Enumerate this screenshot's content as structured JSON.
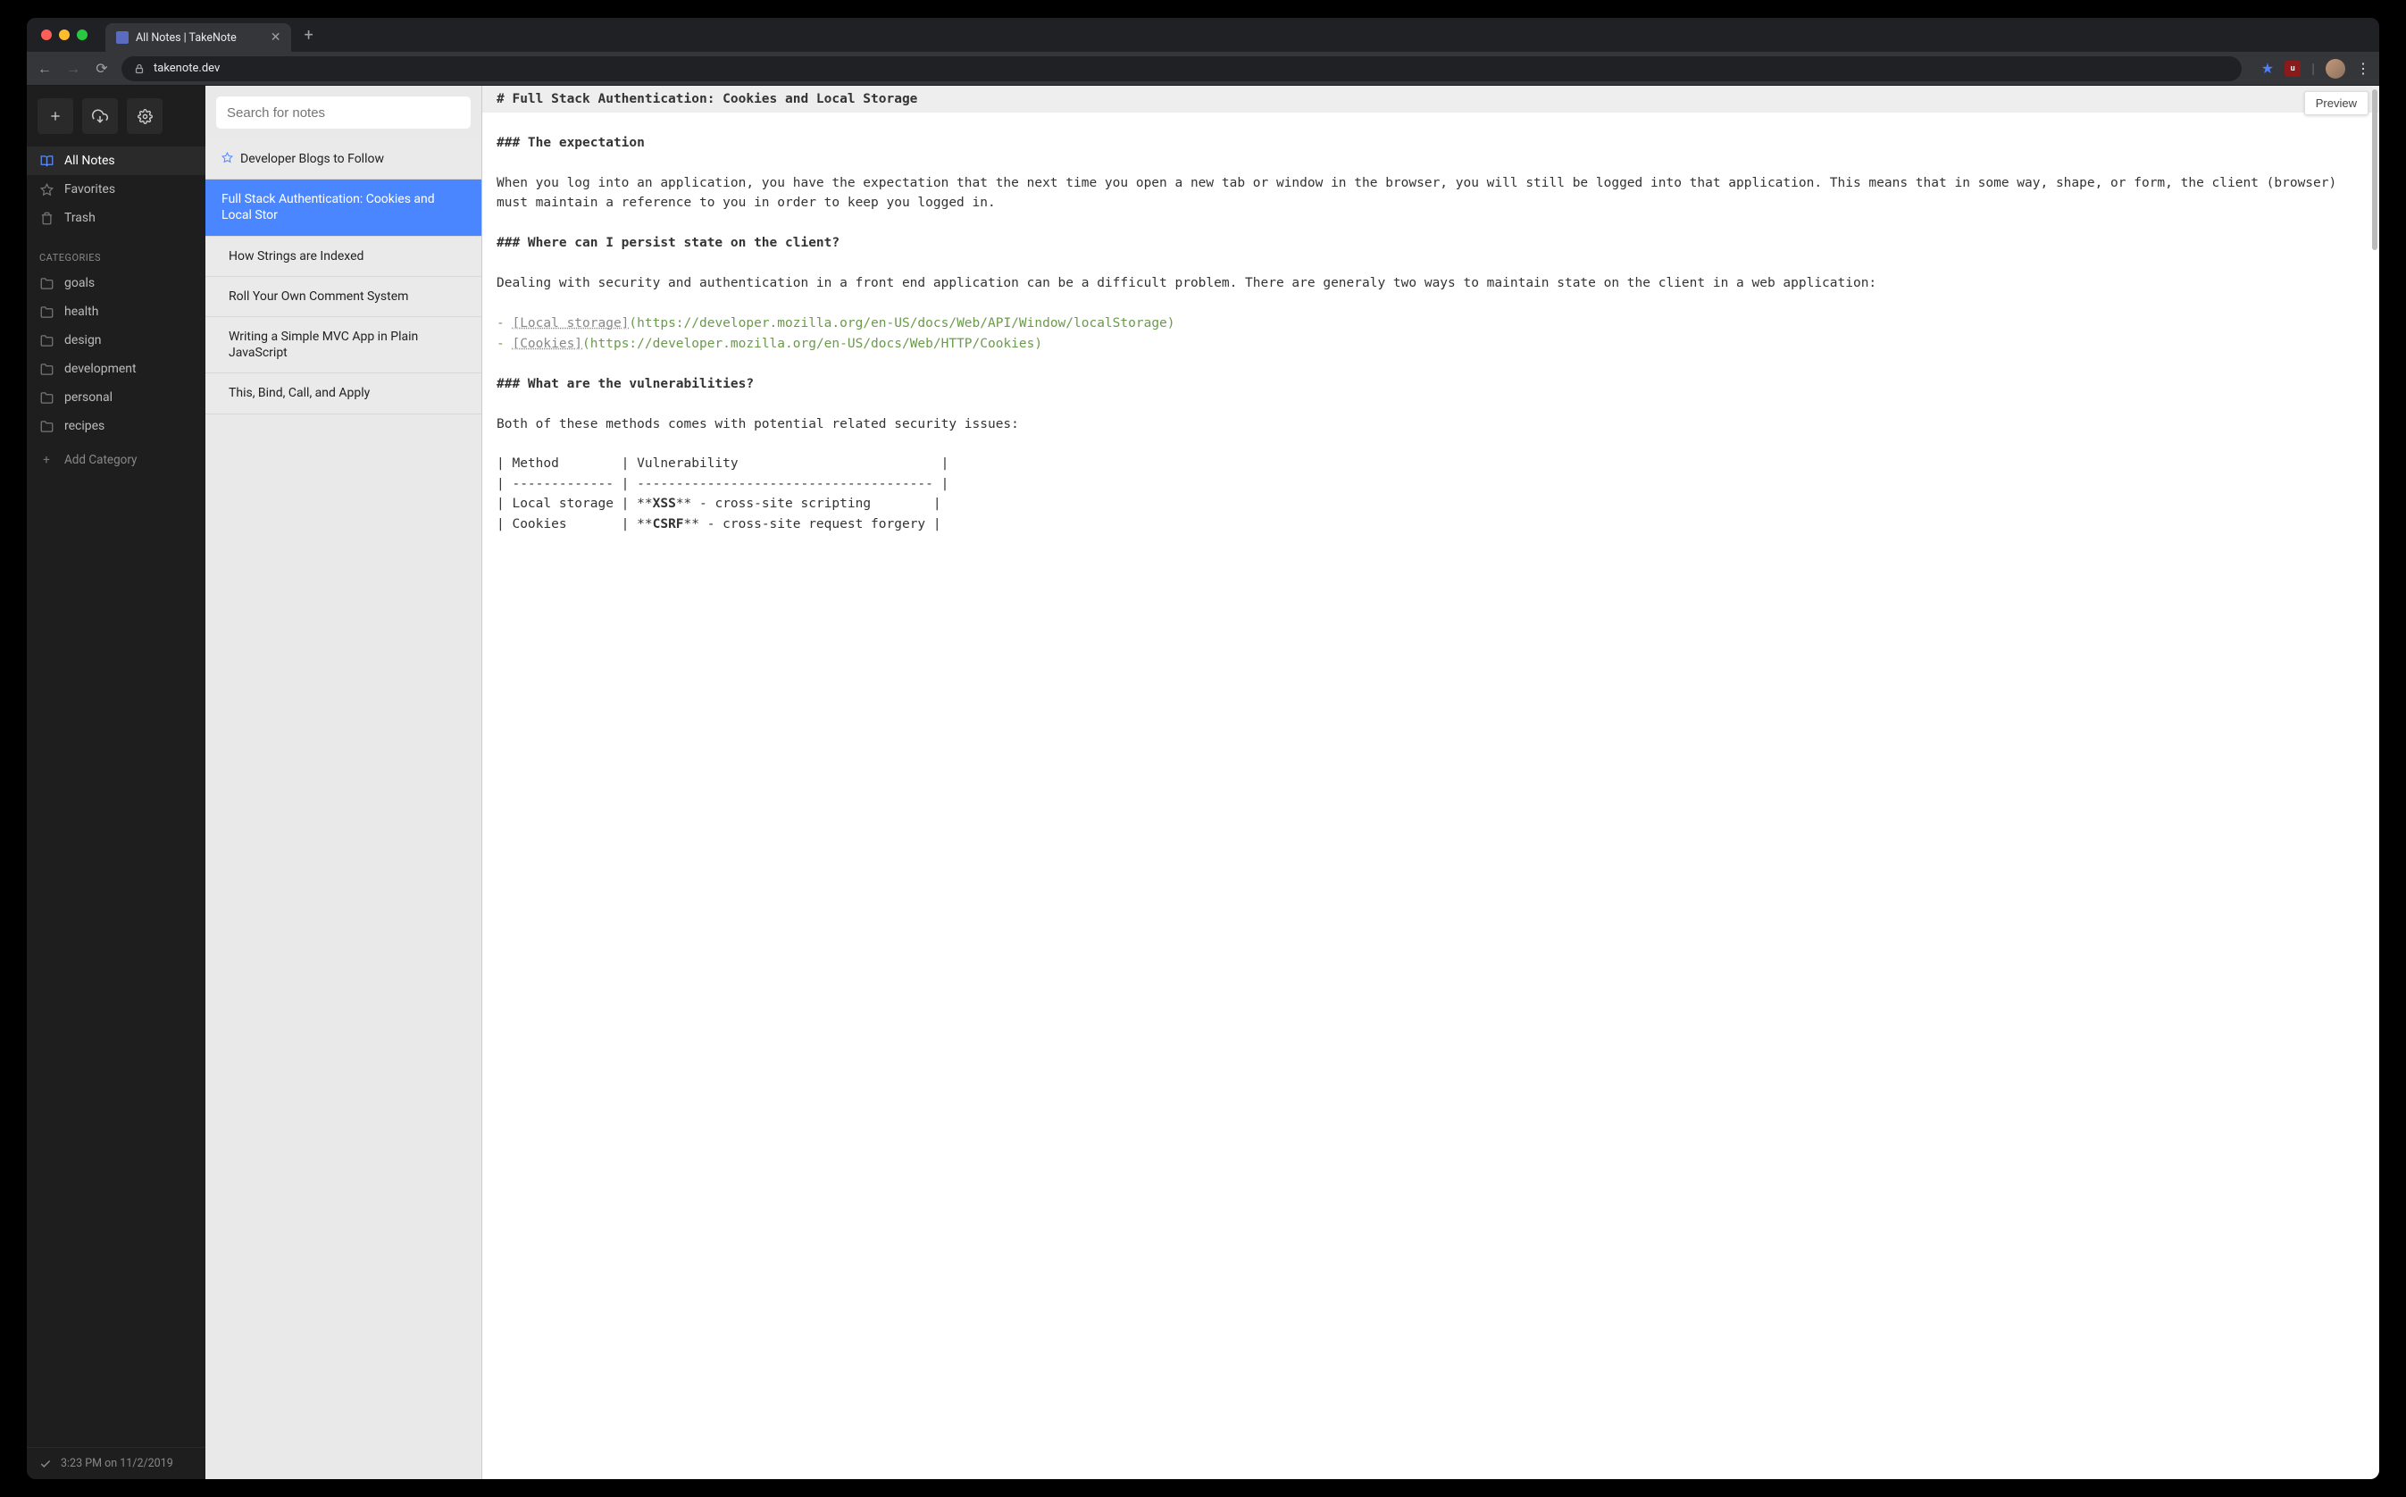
{
  "browser": {
    "tab_title": "All Notes | TakeNote",
    "url": "takenote.dev"
  },
  "sidebar": {
    "nav": [
      {
        "icon": "book",
        "label": "All Notes",
        "active": true
      },
      {
        "icon": "star",
        "label": "Favorites",
        "active": false
      },
      {
        "icon": "trash",
        "label": "Trash",
        "active": false
      }
    ],
    "categories_header": "CATEGORIES",
    "categories": [
      "goals",
      "health",
      "design",
      "development",
      "personal",
      "recipes"
    ],
    "add_category": "Add Category",
    "footer": "3:23 PM on 11/2/2019"
  },
  "search_placeholder": "Search for notes",
  "notes": [
    {
      "title": "Developer Blogs to Follow",
      "starred": true,
      "selected": false
    },
    {
      "title": "Full Stack Authentication: Cookies and Local Stor",
      "starred": false,
      "selected": true
    },
    {
      "title": "How Strings are Indexed",
      "starred": false,
      "selected": false
    },
    {
      "title": "Roll Your Own Comment System",
      "starred": false,
      "selected": false
    },
    {
      "title": "Writing a Simple MVC App in Plain JavaScript",
      "starred": false,
      "selected": false
    },
    {
      "title": "This, Bind, Call, and Apply",
      "starred": false,
      "selected": false
    }
  ],
  "editor": {
    "preview_label": "Preview",
    "h1": "# Full Stack Authentication: Cookies and Local Storage",
    "h3_1": "### The expectation",
    "p1": "When you log into an application, you have the expectation that the next time you open a new tab or window in the browser, you will still be logged into that application. This means that in some way, shape, or form, the client (browser) must maintain a reference to you in order to keep you logged in.",
    "h3_2": "### Where can I persist state on the client?",
    "p2": "Dealing with security and authentication in a front end application can be a difficult problem. There are generaly two ways to maintain state on the client in a web application:",
    "link1_dash": "- ",
    "link1_text": "[Local storage]",
    "link1_url": "(https://developer.mozilla.org/en-US/docs/Web/API/Window/localStorage)",
    "link2_dash": "- ",
    "link2_text": "[Cookies]",
    "link2_url": "(https://developer.mozilla.org/en-US/docs/Web/HTTP/Cookies)",
    "h3_3": "### What are the vulnerabilities?",
    "p3": "Both of these methods comes with potential related security issues:",
    "table_r1": "| Method        | Vulnerability                          |",
    "table_r2": "| ------------- | -------------------------------------- |",
    "table_r3_a": "| Local storage | **",
    "table_r3_b": "XSS",
    "table_r3_c": "** - cross-site scripting        |",
    "table_r4_a": "| Cookies       | **",
    "table_r4_b": "CSRF",
    "table_r4_c": "** - cross-site request forgery |"
  }
}
